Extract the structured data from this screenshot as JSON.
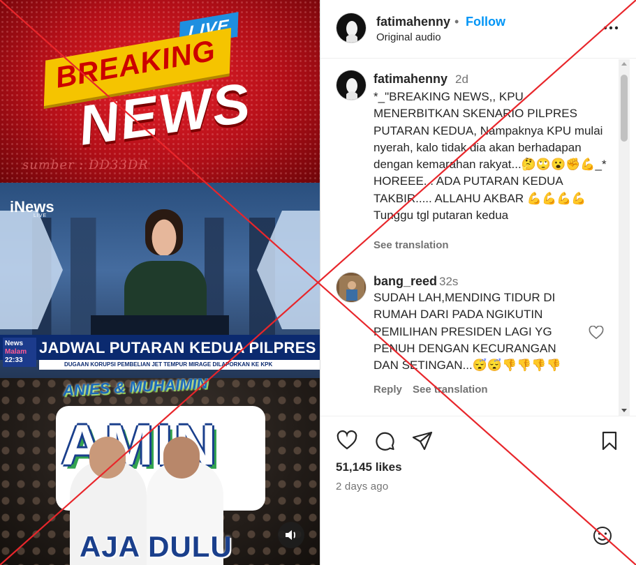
{
  "media": {
    "panel1": {
      "live_badge": "LIVE",
      "breaking": "BREAKING",
      "news": "NEWS",
      "watermark": "sumber : DD33DR"
    },
    "panel2": {
      "channel_logo": "iNews",
      "channel_sub": "LIVE",
      "program_logo_top": "News",
      "program_logo_bottom": "Malam",
      "clock": "22:33",
      "headline": "JADWAL PUTARAN KEDUA PILPRES",
      "ticker": "DUGAAN KORUPSI PEMBELIAN JET TEMPUR MIRAGE DILAPORKAN KE KPK"
    },
    "panel3": {
      "top_text": "ANIES & MUHAIMIN",
      "big_text": "AMIN",
      "bottom_text": "AJA DULU"
    },
    "sound_icon": "speaker-icon"
  },
  "header": {
    "username": "fatimahenny",
    "separator": "•",
    "follow_label": "Follow",
    "audio": "Original audio",
    "more_icon": "more-horizontal-icon"
  },
  "caption": {
    "username": "fatimahenny",
    "time": "2d",
    "text": "*_\"BREAKING NEWS,, KPU MENERBITKAN SKENARIO PILPRES PUTARAN KEDUA, Nampaknya KPU mulai nyerah, kalo tidak dia akan berhadapan dengan kemarahan rakyat...🤔🙄😮✊💪_* HOREEE... ADA PUTARAN KEDUA TAKBIR..... ALLAHU AKBAR 💪💪💪💪\nTunggu tgl putaran kedua",
    "see_translation": "See translation"
  },
  "comment": {
    "username": "bang_reed",
    "time": "32s",
    "text": "SUDAH LAH,MENDING TIDUR DI RUMAH DARI PADA NGIKUTIN PEMILIHAN PRESIDEN LAGI YG PENUH DENGAN KECURANGAN DAN SETINGAN...😴😴👎👎👎👎",
    "reply_label": "Reply",
    "see_translation": "See translation"
  },
  "actions": {
    "like_icon": "heart-icon",
    "comment_icon": "comment-icon",
    "share_icon": "share-icon",
    "save_icon": "bookmark-icon"
  },
  "likes": "51,145 likes",
  "posted": "2 days ago",
  "emoji_icon": "emoji-icon",
  "overlay_color": "#e8262b"
}
